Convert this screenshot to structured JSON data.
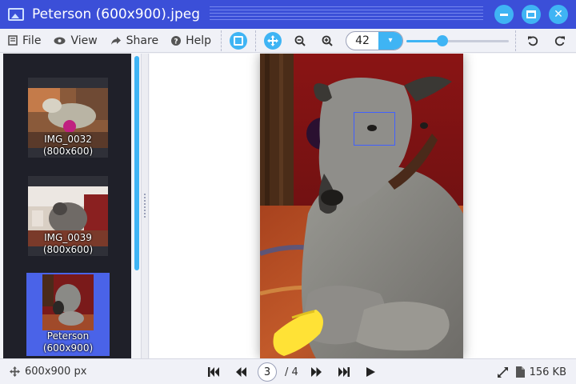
{
  "window": {
    "title": "Peterson (600x900).jpeg",
    "close_glyph": "✕"
  },
  "menu": {
    "file": "File",
    "view": "View",
    "share": "Share",
    "help": "Help"
  },
  "zoom": {
    "value": "42",
    "dropdown_glyph": "▾",
    "slider_fraction": 0.35
  },
  "thumbnails": [
    {
      "name": "IMG_0032",
      "size": "(800x600)"
    },
    {
      "name": "IMG_0039",
      "size": "(800x600)"
    },
    {
      "name": "Peterson",
      "size": "(600x900)",
      "selected": true
    }
  ],
  "status": {
    "dimensions": "600x900 px",
    "current_page": "3",
    "total_pages": "/ 4",
    "file_size": "156 KB"
  },
  "colors": {
    "accent": "#3fb4f4",
    "titlebar": "#3b4fd8",
    "selection": "#4a63e8",
    "sidebar_bg": "#1f2029"
  },
  "icons": [
    "image-icon",
    "minimize-icon",
    "maximize-icon",
    "close-icon",
    "file-icon",
    "eye-icon",
    "share-icon",
    "help-icon",
    "select-icon",
    "move-icon",
    "zoom-out-icon",
    "zoom-in-icon",
    "rotate-left-icon",
    "rotate-right-icon",
    "move-icon",
    "first-icon",
    "previous-icon",
    "next-icon",
    "last-icon",
    "play-icon",
    "fullscreen-icon",
    "document-icon"
  ]
}
